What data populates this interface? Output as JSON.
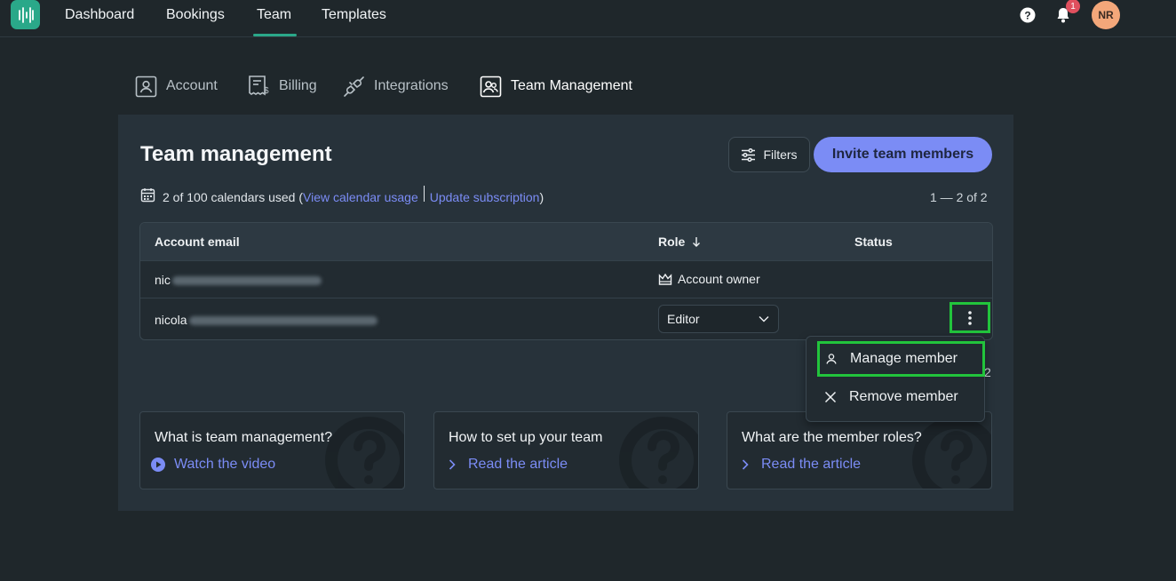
{
  "topnav": {
    "items": [
      "Dashboard",
      "Bookings",
      "Team",
      "Templates"
    ],
    "active": "Team",
    "notifications": "1",
    "avatar_initials": "NR"
  },
  "subtabs": [
    "Account",
    "Billing",
    "Integrations",
    "Team Management"
  ],
  "page": {
    "title": "Team management",
    "filters_label": "Filters",
    "invite_label": "Invite team members",
    "usage_text": "2 of 100 calendars used",
    "view_usage_link": "View calendar usage",
    "update_subscription_link": "Update subscription",
    "range_top": "1 — 2 of 2",
    "range_bottom": "2"
  },
  "table": {
    "headers": [
      "Account email",
      "Role",
      "Status"
    ],
    "rows": [
      {
        "email_prefix": "nic",
        "role": "Account owner"
      },
      {
        "email_prefix": "nicola",
        "role": "Editor"
      }
    ]
  },
  "menu": {
    "items": [
      "Manage member",
      "Remove member"
    ]
  },
  "cards": [
    {
      "title": "What is team management?",
      "link": "Watch the video"
    },
    {
      "title": "How to set up your team",
      "link": "Read the article"
    },
    {
      "title": "What are the member roles?",
      "link": "Read the article"
    }
  ],
  "colors": {
    "accent_green": "#2aa889",
    "link_purple": "#7b8cf5",
    "highlight_green": "#22c43c",
    "badge_red": "#e0505e"
  }
}
